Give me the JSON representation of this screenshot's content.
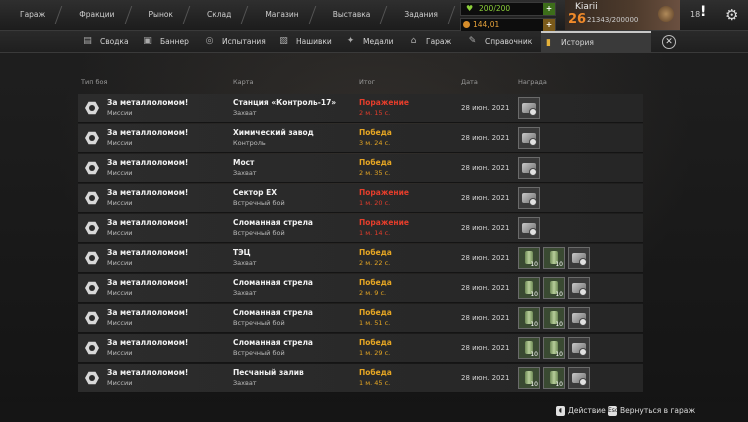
{
  "topnav": [
    "Гараж",
    "Фракции",
    "Рынок",
    "Склад",
    "Магазин",
    "Выставка",
    "Задания"
  ],
  "resources": {
    "energy": "200/200",
    "coins": "144,01"
  },
  "player": {
    "name": "Kiarii",
    "level": "26",
    "xp": "21343/200000"
  },
  "notifications": "18",
  "tabs": [
    "Сводка",
    "Баннер",
    "Испытания",
    "Нашивки",
    "Медали",
    "Гараж",
    "Справочник",
    "История"
  ],
  "active_tab": "История",
  "table": {
    "headers": {
      "type": "Тип боя",
      "map": "Карта",
      "result": "Итог",
      "date": "Дата",
      "reward": "Награда"
    },
    "rows": [
      {
        "name": "За металлоломом!",
        "category": "Миссии",
        "map": "Станция «Контроль-17»",
        "mode": "Захват",
        "result": "Поражение",
        "duration": "2 м. 15 с.",
        "outcome": "loss",
        "date": "28 июн. 2021",
        "rewards": [
          {
            "type": "vehicle",
            "qty": ""
          }
        ]
      },
      {
        "name": "За металлоломом!",
        "category": "Миссии",
        "map": "Химический завод",
        "mode": "Контроль",
        "result": "Победа",
        "duration": "3 м. 24 с.",
        "outcome": "win",
        "date": "28 июн. 2021",
        "rewards": [
          {
            "type": "vehicle",
            "qty": ""
          }
        ]
      },
      {
        "name": "За металлоломом!",
        "category": "Миссии",
        "map": "Мост",
        "mode": "Захват",
        "result": "Победа",
        "duration": "2 м. 35 с.",
        "outcome": "win",
        "date": "28 июн. 2021",
        "rewards": [
          {
            "type": "vehicle",
            "qty": ""
          }
        ]
      },
      {
        "name": "За металлоломом!",
        "category": "Миссии",
        "map": "Сектор EX",
        "mode": "Встречный бой",
        "result": "Поражение",
        "duration": "1 м. 20 с.",
        "outcome": "loss",
        "date": "28 июн. 2021",
        "rewards": [
          {
            "type": "vehicle",
            "qty": ""
          }
        ]
      },
      {
        "name": "За металлоломом!",
        "category": "Миссии",
        "map": "Сломанная стрела",
        "mode": "Встречный бой",
        "result": "Поражение",
        "duration": "1 м. 14 с.",
        "outcome": "loss",
        "date": "28 июн. 2021",
        "rewards": [
          {
            "type": "vehicle",
            "qty": ""
          }
        ]
      },
      {
        "name": "За металлоломом!",
        "category": "Миссии",
        "map": "ТЭЦ",
        "mode": "Захват",
        "result": "Победа",
        "duration": "2 м. 22 с.",
        "outcome": "win",
        "date": "28 июн. 2021",
        "rewards": [
          {
            "type": "can",
            "qty": "10"
          },
          {
            "type": "can",
            "qty": "10"
          },
          {
            "type": "vehicle",
            "qty": ""
          }
        ]
      },
      {
        "name": "За металлоломом!",
        "category": "Миссии",
        "map": "Сломанная стрела",
        "mode": "Захват",
        "result": "Победа",
        "duration": "2 м. 9 с.",
        "outcome": "win",
        "date": "28 июн. 2021",
        "rewards": [
          {
            "type": "can",
            "qty": "10"
          },
          {
            "type": "can",
            "qty": "10"
          },
          {
            "type": "vehicle",
            "qty": ""
          }
        ]
      },
      {
        "name": "За металлоломом!",
        "category": "Миссии",
        "map": "Сломанная стрела",
        "mode": "Встречный бой",
        "result": "Победа",
        "duration": "1 м. 51 с.",
        "outcome": "win",
        "date": "28 июн. 2021",
        "rewards": [
          {
            "type": "can",
            "qty": "10"
          },
          {
            "type": "can",
            "qty": "10"
          },
          {
            "type": "vehicle",
            "qty": ""
          }
        ]
      },
      {
        "name": "За металлоломом!",
        "category": "Миссии",
        "map": "Сломанная стрела",
        "mode": "Встречный бой",
        "result": "Победа",
        "duration": "1 м. 29 с.",
        "outcome": "win",
        "date": "28 июн. 2021",
        "rewards": [
          {
            "type": "can",
            "qty": "10"
          },
          {
            "type": "can",
            "qty": "10"
          },
          {
            "type": "vehicle",
            "qty": ""
          }
        ]
      },
      {
        "name": "За металлоломом!",
        "category": "Миссии",
        "map": "Песчаный залив",
        "mode": "Захват",
        "result": "Победа",
        "duration": "1 м. 45 с.",
        "outcome": "win",
        "date": "28 июн. 2021",
        "rewards": [
          {
            "type": "can",
            "qty": "10"
          },
          {
            "type": "can",
            "qty": "10"
          },
          {
            "type": "vehicle",
            "qty": ""
          }
        ]
      }
    ]
  },
  "footer": {
    "action": "Действие",
    "back": "Вернуться в гараж"
  }
}
